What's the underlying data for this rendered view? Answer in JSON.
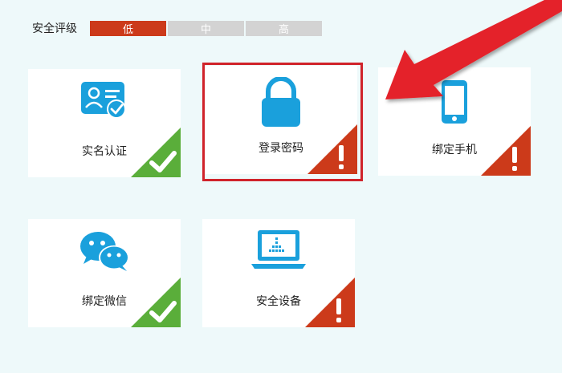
{
  "security_rating": {
    "label": "安全评级",
    "levels": [
      {
        "text": "低",
        "active": true
      },
      {
        "text": "中",
        "active": false
      },
      {
        "text": "高",
        "active": false
      }
    ]
  },
  "cards": {
    "real_name": {
      "label": "实名认证",
      "status": "verified",
      "icon": "id-card-icon"
    },
    "login_password": {
      "label": "登录密码",
      "status": "warning",
      "icon": "lock-icon"
    },
    "bind_phone": {
      "label": "绑定手机",
      "status": "warning",
      "icon": "phone-icon"
    },
    "bind_wechat": {
      "label": "绑定微信",
      "status": "verified",
      "icon": "wechat-icon"
    },
    "security_device": {
      "label": "安全设备",
      "status": "warning",
      "icon": "laptop-icon"
    }
  },
  "colors": {
    "accent_blue": "#1aa0dc",
    "verified_green": "#5aae3a",
    "warning_red": "#cc3a1a",
    "highlight_red": "#d0232a"
  }
}
